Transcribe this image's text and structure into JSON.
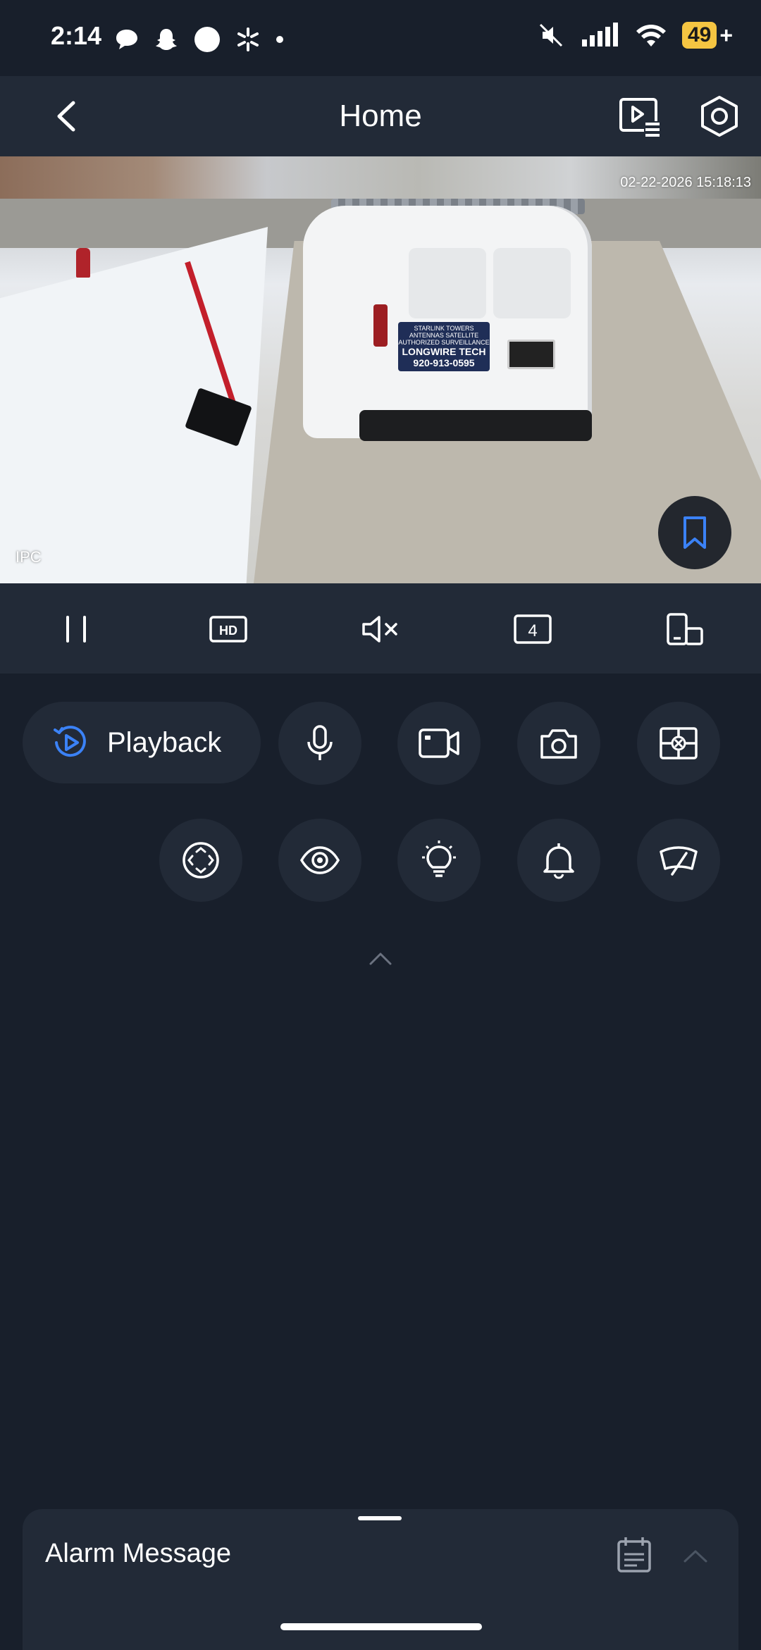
{
  "status_bar": {
    "time": "2:14",
    "battery": "49",
    "battery_suffix": "+"
  },
  "nav": {
    "title": "Home"
  },
  "video": {
    "timestamp": "02-22-2026 15:18:13",
    "label": "IPC",
    "van_sign_line1": "STARLINK TOWERS",
    "van_sign_line2": "ANTENNAS SATELLITE",
    "van_sign_line3": "AUTHORIZED SURVEILLANCE",
    "van_sign_line4": "LONGWIRE TECH",
    "van_sign_phone": "920-913-0595"
  },
  "controls": {
    "quality": "HD",
    "split_count": "4"
  },
  "actions": {
    "playback_label": "Playback"
  },
  "alarm": {
    "title": "Alarm Message"
  },
  "colors": {
    "background": "#181f2b",
    "panel": "#222a37",
    "accent": "#3b82f6",
    "battery": "#f5c542"
  }
}
